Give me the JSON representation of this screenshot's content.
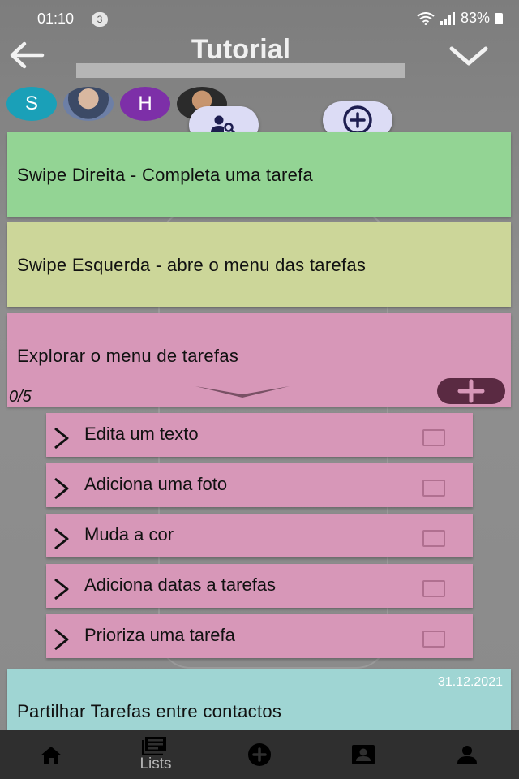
{
  "status_bar": {
    "time": "01:10",
    "notification_count": "3",
    "battery": "83%"
  },
  "header": {
    "title": "Tutorial"
  },
  "avatars": [
    {
      "initial": "S",
      "color": "#1aa0b8"
    },
    {
      "initial": "",
      "color": ""
    },
    {
      "initial": "H",
      "color": "#7d2fa8"
    },
    {
      "initial": "",
      "color": ""
    }
  ],
  "tasks": [
    {
      "label": "Swipe Direita - Completa uma tarefa",
      "color": "#93d494"
    },
    {
      "label": "Swipe Esquerda - abre o menu das tarefas",
      "color": "#ccd699"
    },
    {
      "label": "Explorar o menu de tarefas",
      "color": "#d797b8",
      "progress": "0/5"
    },
    {
      "label": "Partilhar Tarefas entre contactos",
      "color": "#9fd5d3",
      "date": "31.12.2021"
    }
  ],
  "subtasks": [
    {
      "label": "Edita um texto",
      "checked": false
    },
    {
      "label": "Adiciona uma foto",
      "checked": false
    },
    {
      "label": "Muda a cor",
      "checked": false
    },
    {
      "label": "Adiciona datas a tarefas",
      "checked": false
    },
    {
      "label": "Prioriza uma tarefa",
      "checked": false
    }
  ],
  "bottom_nav": {
    "items": [
      {
        "icon": "home-icon",
        "label": ""
      },
      {
        "icon": "lists-icon",
        "label": "Lists"
      },
      {
        "icon": "add-circle-icon",
        "label": ""
      },
      {
        "icon": "contact-card-icon",
        "label": ""
      },
      {
        "icon": "person-icon",
        "label": ""
      }
    ]
  }
}
